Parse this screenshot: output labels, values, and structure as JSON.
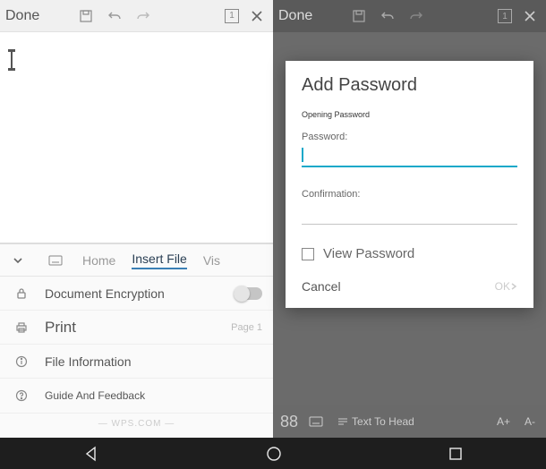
{
  "left": {
    "done": "Done",
    "page_indicator": "1",
    "tabs": {
      "home": "Home",
      "insert": "Insert File",
      "view": "Vis"
    },
    "rows": {
      "encryption": "Document Encryption",
      "print": "Print",
      "print_page": "Page 1",
      "fileinfo": "File Information",
      "feedback": "Guide And Feedback"
    },
    "footer": "WPS.COM"
  },
  "right": {
    "done": "Done",
    "page_indicator": "1",
    "dialog": {
      "title": "Add Password",
      "subtitle": "Opening Password",
      "password_label": "Password:",
      "password_value": "",
      "confirm_label": "Confirmation:",
      "confirm_value": "",
      "view_password": "View Password",
      "cancel": "Cancel",
      "ok": "OK"
    },
    "bottom": {
      "font_size": "88",
      "text_to_head": "Text To Head",
      "a_plus": "A+",
      "a_minus": "A-"
    }
  }
}
